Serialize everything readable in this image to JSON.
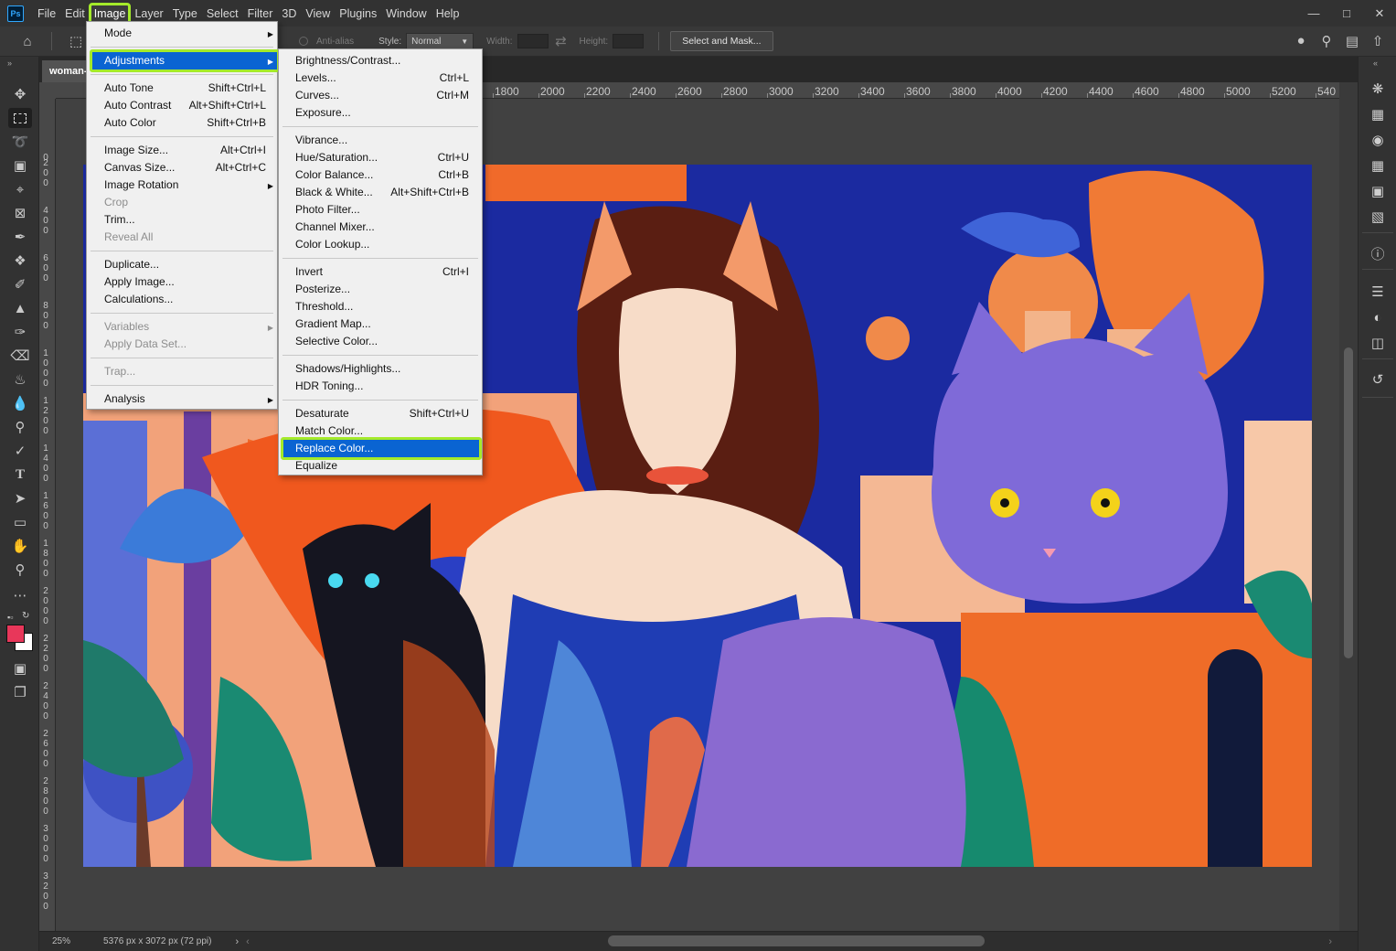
{
  "app": {
    "logo": "Ps"
  },
  "menubar": {
    "items": [
      "File",
      "Edit",
      "Image",
      "Layer",
      "Type",
      "Select",
      "Filter",
      "3D",
      "View",
      "Plugins",
      "Window",
      "Help"
    ],
    "active": "Image"
  },
  "window_controls": [
    "minimize-icon",
    "maximize-icon",
    "close-icon"
  ],
  "options": {
    "anti_alias": "Anti-alias",
    "style_label": "Style:",
    "style_value": "Normal",
    "width_label": "Width:",
    "height_label": "Height:",
    "select_and_mask": "Select and Mask..."
  },
  "document": {
    "tab_title": "woman-",
    "zoom": "25%",
    "doc_info": "5376 px x 3072 px (72 ppi)"
  },
  "ruler_top": [
    "1800",
    "2000",
    "2200",
    "2400",
    "2600",
    "2800",
    "3000",
    "3200",
    "3400",
    "3600",
    "3800",
    "4000",
    "4200",
    "4400",
    "4600",
    "4800",
    "5000",
    "5200",
    "540"
  ],
  "ruler_left": [
    [
      "0"
    ],
    [
      "2",
      "0",
      "0"
    ],
    [
      "4",
      "0",
      "0"
    ],
    [
      "6",
      "0",
      "0"
    ],
    [
      "8",
      "0",
      "0"
    ],
    [
      "1",
      "0",
      "0",
      "0"
    ],
    [
      "1",
      "2",
      "0",
      "0"
    ],
    [
      "1",
      "4",
      "0",
      "0"
    ],
    [
      "1",
      "6",
      "0",
      "0"
    ],
    [
      "1",
      "8",
      "0",
      "0"
    ],
    [
      "2",
      "0",
      "0",
      "0"
    ],
    [
      "2",
      "2",
      "0",
      "0"
    ],
    [
      "2",
      "4",
      "0",
      "0"
    ],
    [
      "2",
      "6",
      "0",
      "0"
    ],
    [
      "2",
      "8",
      "0",
      "0"
    ],
    [
      "3",
      "0",
      "0",
      "0"
    ],
    [
      "3",
      "2",
      "0",
      "0"
    ]
  ],
  "image_menu": {
    "groups": [
      [
        {
          "label": "Mode",
          "submenu": true
        }
      ],
      [
        {
          "label": "Adjustments",
          "submenu": true,
          "highlighted": true
        }
      ],
      [
        {
          "label": "Auto Tone",
          "shortcut": "Shift+Ctrl+L"
        },
        {
          "label": "Auto Contrast",
          "shortcut": "Alt+Shift+Ctrl+L"
        },
        {
          "label": "Auto Color",
          "shortcut": "Shift+Ctrl+B"
        }
      ],
      [
        {
          "label": "Image Size...",
          "shortcut": "Alt+Ctrl+I"
        },
        {
          "label": "Canvas Size...",
          "shortcut": "Alt+Ctrl+C"
        },
        {
          "label": "Image Rotation",
          "submenu": true
        },
        {
          "label": "Crop",
          "disabled": true
        },
        {
          "label": "Trim..."
        },
        {
          "label": "Reveal All",
          "disabled": true
        }
      ],
      [
        {
          "label": "Duplicate..."
        },
        {
          "label": "Apply Image..."
        },
        {
          "label": "Calculations..."
        }
      ],
      [
        {
          "label": "Variables",
          "submenu": true,
          "disabled": true
        },
        {
          "label": "Apply Data Set...",
          "disabled": true
        }
      ],
      [
        {
          "label": "Trap...",
          "disabled": true
        }
      ],
      [
        {
          "label": "Analysis",
          "submenu": true
        }
      ]
    ]
  },
  "adjustments_menu": {
    "groups": [
      [
        {
          "label": "Brightness/Contrast..."
        },
        {
          "label": "Levels...",
          "shortcut": "Ctrl+L"
        },
        {
          "label": "Curves...",
          "shortcut": "Ctrl+M"
        },
        {
          "label": "Exposure..."
        }
      ],
      [
        {
          "label": "Vibrance..."
        },
        {
          "label": "Hue/Saturation...",
          "shortcut": "Ctrl+U"
        },
        {
          "label": "Color Balance...",
          "shortcut": "Ctrl+B"
        },
        {
          "label": "Black & White...",
          "shortcut": "Alt+Shift+Ctrl+B"
        },
        {
          "label": "Photo Filter..."
        },
        {
          "label": "Channel Mixer..."
        },
        {
          "label": "Color Lookup..."
        }
      ],
      [
        {
          "label": "Invert",
          "shortcut": "Ctrl+I"
        },
        {
          "label": "Posterize..."
        },
        {
          "label": "Threshold..."
        },
        {
          "label": "Gradient Map..."
        },
        {
          "label": "Selective Color..."
        }
      ],
      [
        {
          "label": "Shadows/Highlights..."
        },
        {
          "label": "HDR Toning..."
        }
      ],
      [
        {
          "label": "Desaturate",
          "shortcut": "Shift+Ctrl+U"
        },
        {
          "label": "Match Color..."
        },
        {
          "label": "Replace Color...",
          "highlighted": true
        },
        {
          "label": "Equalize"
        }
      ]
    ]
  },
  "colors": {
    "highlight_outline": "#a4ea2a",
    "menu_highlight": "#0a64d2",
    "foreground_swatch": "#e8375a",
    "background_swatch": "#ffffff"
  }
}
